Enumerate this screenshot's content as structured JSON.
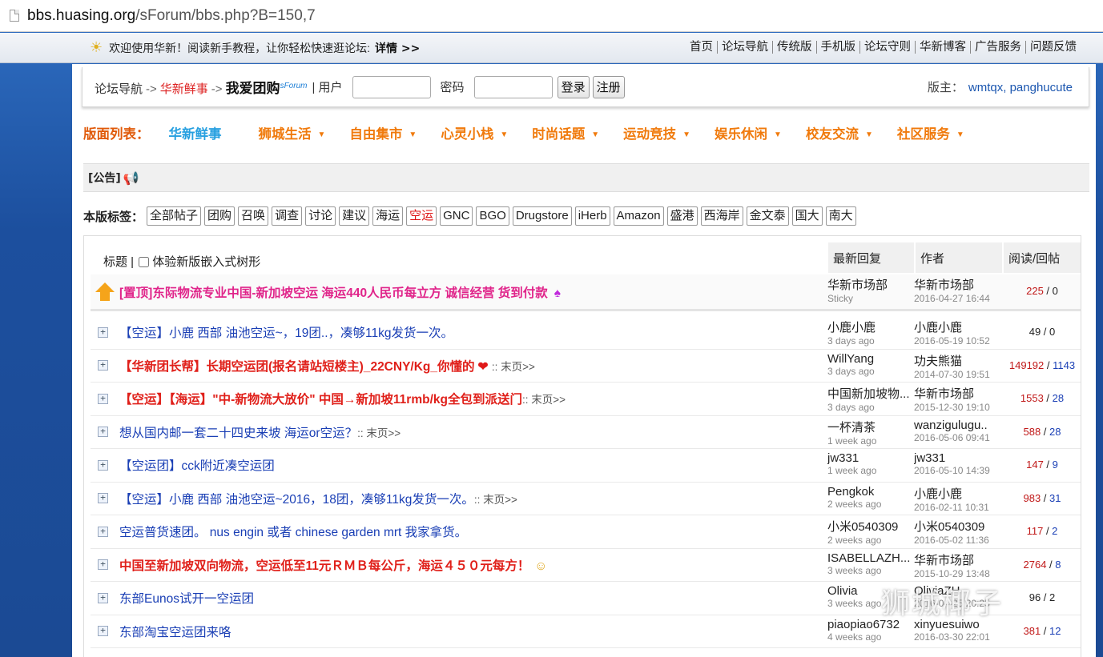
{
  "browser": {
    "url_host": "bbs.huasing.org",
    "url_path": "/sForum/bbs.php?B=150,7"
  },
  "topbar": {
    "welcome": "欢迎使用华新！阅读新手教程，让你轻松快速逛论坛:",
    "more": "详情 >>",
    "links": [
      "首页",
      "论坛导航",
      "传统版",
      "手机版",
      "论坛守则",
      "华新博客",
      "广告服务",
      "问题反馈"
    ]
  },
  "navbar": {
    "crumb_root": "论坛导航",
    "crumb_arrow": "->",
    "crumb_board": "华新鲜事",
    "crumb_current": "我爱团购",
    "crumb_sup": "sForum",
    "user_label": "| 用户",
    "password_label": "密码",
    "login": "登录",
    "register": "注册",
    "moderator_label": "版主：",
    "moderators": "wmtqx, panghucute"
  },
  "boards": {
    "title": "版面列表：",
    "items": [
      "华新鲜事",
      "狮城生活",
      "自由集市",
      "心灵小栈",
      "时尚话题",
      "运动竞技",
      "娱乐休闲",
      "校友交流",
      "社区服务"
    ]
  },
  "notice": {
    "label": "[公告]"
  },
  "tags": {
    "label": "本版标签：",
    "items": [
      "全部帖子",
      "团购",
      "召唤",
      "调查",
      "讨论",
      "建议",
      "海运",
      "空运",
      "GNC",
      "BGO",
      "Drugstore",
      "iHerb",
      "Amazon",
      "盛港",
      "西海岸",
      "金文泰",
      "国大",
      "南大"
    ],
    "active": "空运"
  },
  "table": {
    "headers": {
      "title": "标题 |",
      "tree_option": "体验新版嵌入式树形",
      "reply": "最新回复",
      "author": "作者",
      "stats": "阅读/回帖"
    },
    "sticky": {
      "title": "[置顶]东际物流专业中国-新加坡空运 海运440人民币每立方 诚信经营 货到付款",
      "reply_name": "华新市场部",
      "reply_sub": "Sticky",
      "author_name": "华新市场部",
      "author_date": "2016-04-27 16:44",
      "reads": "225",
      "posts": "0"
    },
    "rows": [
      {
        "title": "【空运】小鹿 西部 油池空运~，19团..，凑够11kg发货一次。",
        "last": "",
        "reply_name": "小鹿小鹿",
        "reply_sub": "3 days ago",
        "author_name": "小鹿小鹿",
        "author_date": "2016-05-19 10:52",
        "reads": "49",
        "posts": "0"
      },
      {
        "title": "【华新团长帮】长期空运团(报名请站短楼主)_22CNY/Kg_你懂的",
        "last": ":: 末页>>",
        "reply_name": "WillYang",
        "reply_sub": "3 days ago",
        "author_name": "功夫熊猫",
        "author_date": "2014-07-30 19:51",
        "reads": "149192",
        "posts": "1143"
      },
      {
        "title": "【空运】【海运】\"中-新物流大放价\" 中国→新加坡11rmb/kg全包到派送门",
        "last": ":: 末页>>",
        "reply_name": "中国新加坡物...",
        "reply_sub": "3 days ago",
        "author_name": "华新市场部",
        "author_date": "2015-12-30 19:10",
        "reads": "1553",
        "posts": "28"
      },
      {
        "title": "想从国内邮一套二十四史来坡 海运or空运？",
        "last": ":: 末页>>",
        "reply_name": "一杯清茶",
        "reply_sub": "1 week ago",
        "author_name": "wanzigulugu..",
        "author_date": "2016-05-06 09:41",
        "reads": "588",
        "posts": "28"
      },
      {
        "title": "【空运团】cck附近凑空运团",
        "last": "",
        "reply_name": "jw331",
        "reply_sub": "1 week ago",
        "author_name": "jw331",
        "author_date": "2016-05-10 14:39",
        "reads": "147",
        "posts": "9"
      },
      {
        "title": "【空运】小鹿 西部 油池空运~2016，18团，凑够11kg发货一次。",
        "last": ":: 末页>>",
        "reply_name": "Pengkok",
        "reply_sub": "2 weeks ago",
        "author_name": "小鹿小鹿",
        "author_date": "2016-02-11 10:31",
        "reads": "983",
        "posts": "31"
      },
      {
        "title": "空运普货速团。 nus engin 或者 chinese garden mrt 我家拿货。",
        "last": "",
        "reply_name": "小米0540309",
        "reply_sub": "2 weeks ago",
        "author_name": "小米0540309",
        "author_date": "2016-05-02 11:36",
        "reads": "117",
        "posts": "2"
      },
      {
        "title": "中国至新加坡双向物流，空运低至11元ＲＭＢ每公斤，海运４５０元每方！",
        "last": "",
        "reply_name": "ISABELLAZH...",
        "reply_sub": "3 weeks ago",
        "author_name": "华新市场部",
        "author_date": "2015-10-29 13:48",
        "reads": "2764",
        "posts": "8"
      },
      {
        "title": "东部Eunos试开一空运团",
        "last": "",
        "reply_name": "Olivia",
        "reply_sub": "3 weeks ago",
        "author_name": "OliviaZH",
        "author_date": "2016-04-25 20:25",
        "reads": "96",
        "posts": "2"
      },
      {
        "title": "东部淘宝空运团来咯",
        "last": "",
        "reply_name": "piaopiao6732",
        "reply_sub": "4 weeks ago",
        "author_name": "xinyuesuiwo",
        "author_date": "2016-03-30 22:01",
        "reads": "381",
        "posts": "12"
      }
    ]
  },
  "watermark": "狮城椰子"
}
